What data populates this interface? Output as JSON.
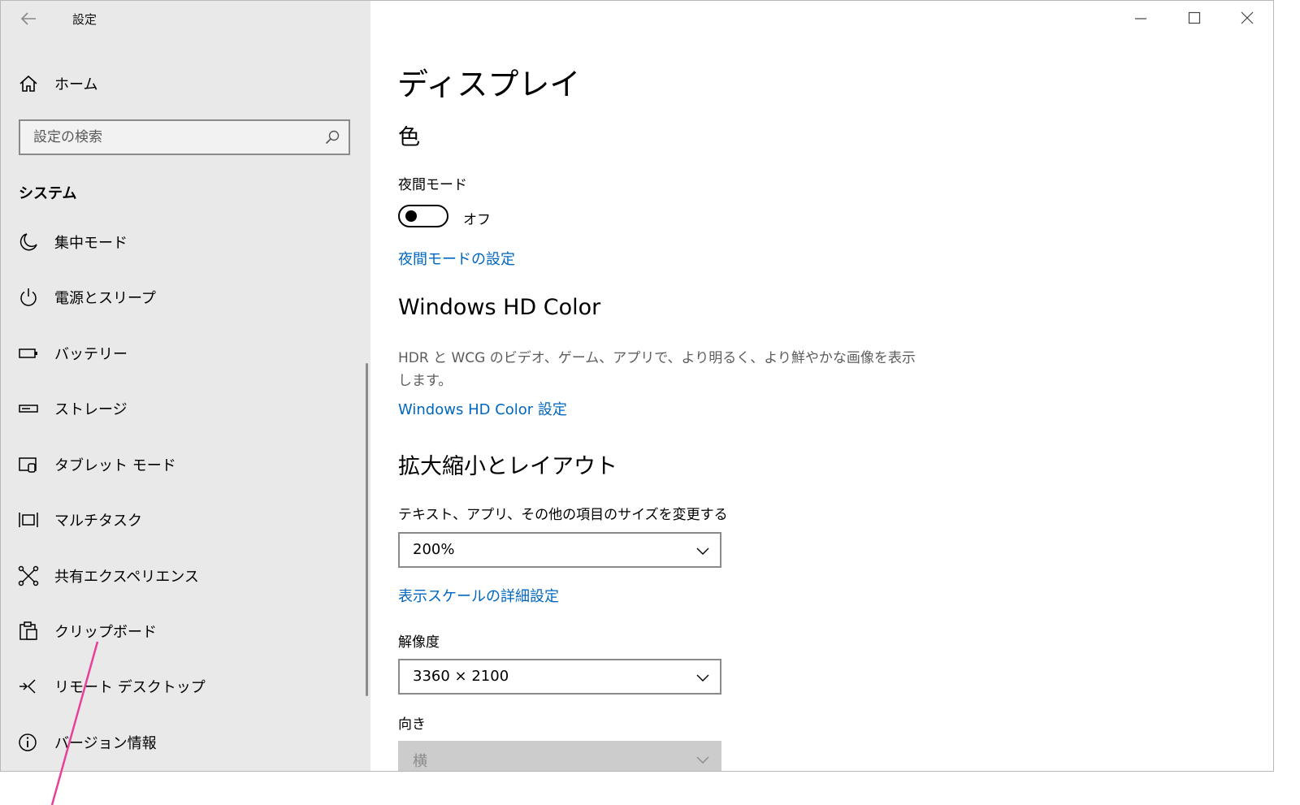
{
  "window": {
    "app_title": "設定"
  },
  "sidebar": {
    "home_label": "ホーム",
    "search_placeholder": "設定の検索",
    "section_title": "システム",
    "items": [
      {
        "label": "集中モード",
        "icon": "moon-icon"
      },
      {
        "label": "電源とスリープ",
        "icon": "power-icon"
      },
      {
        "label": "バッテリー",
        "icon": "battery-icon"
      },
      {
        "label": "ストレージ",
        "icon": "storage-icon"
      },
      {
        "label": "タブレット モード",
        "icon": "tablet-mode-icon"
      },
      {
        "label": "マルチタスク",
        "icon": "multitask-icon"
      },
      {
        "label": "共有エクスペリエンス",
        "icon": "shared-experience-icon"
      },
      {
        "label": "クリップボード",
        "icon": "clipboard-icon"
      },
      {
        "label": "リモート デスクトップ",
        "icon": "remote-desktop-icon"
      },
      {
        "label": "バージョン情報",
        "icon": "info-icon"
      }
    ]
  },
  "main": {
    "page_title": "ディスプレイ",
    "color_section": {
      "title": "色",
      "night_light_label": "夜間モード",
      "night_light_state": "オフ",
      "night_light_on": false,
      "night_light_settings_link": "夜間モードの設定"
    },
    "hdr_section": {
      "title": "Windows HD Color",
      "description": "HDR と WCG のビデオ、ゲーム、アプリで、より明るく、より鮮やかな画像を表示します。",
      "settings_link": "Windows HD Color 設定"
    },
    "scale_section": {
      "title": "拡大縮小とレイアウト",
      "scale_label": "テキスト、アプリ、その他の項目のサイズを変更する",
      "scale_value": "200%",
      "advanced_scaling_link": "表示スケールの詳細設定",
      "resolution_label": "解像度",
      "resolution_value": "3360 × 2100",
      "orientation_label": "向き",
      "orientation_value": "横"
    }
  },
  "colors": {
    "sidebar_bg": "#e9e9e9",
    "link": "#0067c0",
    "annotation": "#e8409a"
  }
}
